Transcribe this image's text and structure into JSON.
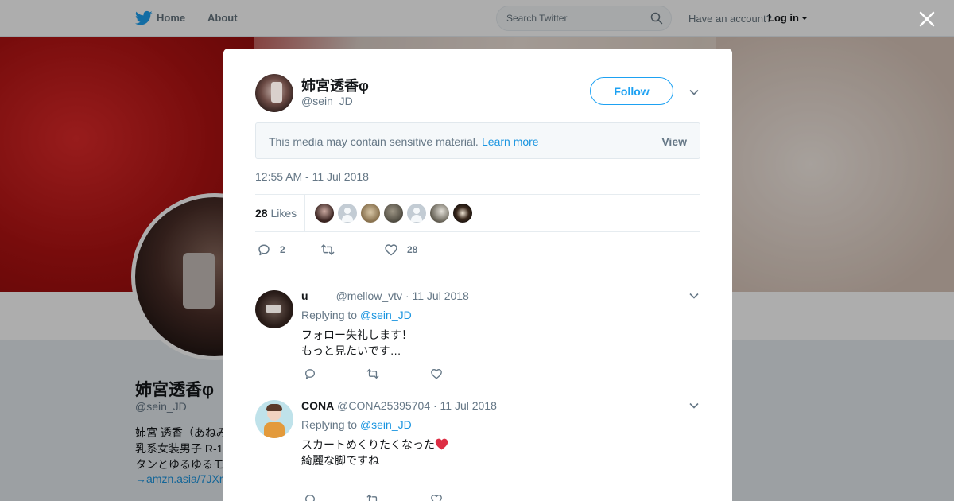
{
  "nav": {
    "home_label": "Home",
    "about_label": "About",
    "search_placeholder": "Search Twitter",
    "account_prompt": "Have an account?",
    "login_label": "Log in"
  },
  "background_profile": {
    "name": "姉宮透香φ",
    "handle": "@sein_JD",
    "bio": "姉宮 透香（あねみ\n乳系女装男子 R-1\nタンとゆるゆるモ",
    "link": "→amzn.asia/7JXr"
  },
  "tweet": {
    "author_name": "姉宮透香φ",
    "author_handle": "@sein_JD",
    "follow_label": "Follow",
    "sensitive_notice": "This media may contain sensitive material.",
    "learn_more_label": "Learn more",
    "view_label": "View",
    "timestamp": "12:55 AM - 11 Jul 2018",
    "likes_count": "28",
    "likes_label": "Likes",
    "reply_count": "2",
    "like_count": "28"
  },
  "replies": [
    {
      "name": "u____",
      "handle": "@mellow_vtv",
      "date": "· 11 Jul 2018",
      "replying_prefix": "Replying to",
      "replying_to": "@sein_JD",
      "text": "フォロー失礼します！\nもっと見たいです…"
    },
    {
      "name": "CONA",
      "handle": "@CONA25395704",
      "date": "· 11 Jul 2018",
      "replying_prefix": "Replying to",
      "replying_to": "@sein_JD",
      "text_line1": "スカートめくりたくなった",
      "text_rest": "\n綺麗な脚ですね"
    }
  ],
  "colors": {
    "brand_blue": "#1da1f2",
    "link_blue": "#1b95e0",
    "secondary_text": "#657786",
    "heart_red": "#dd2e44"
  }
}
